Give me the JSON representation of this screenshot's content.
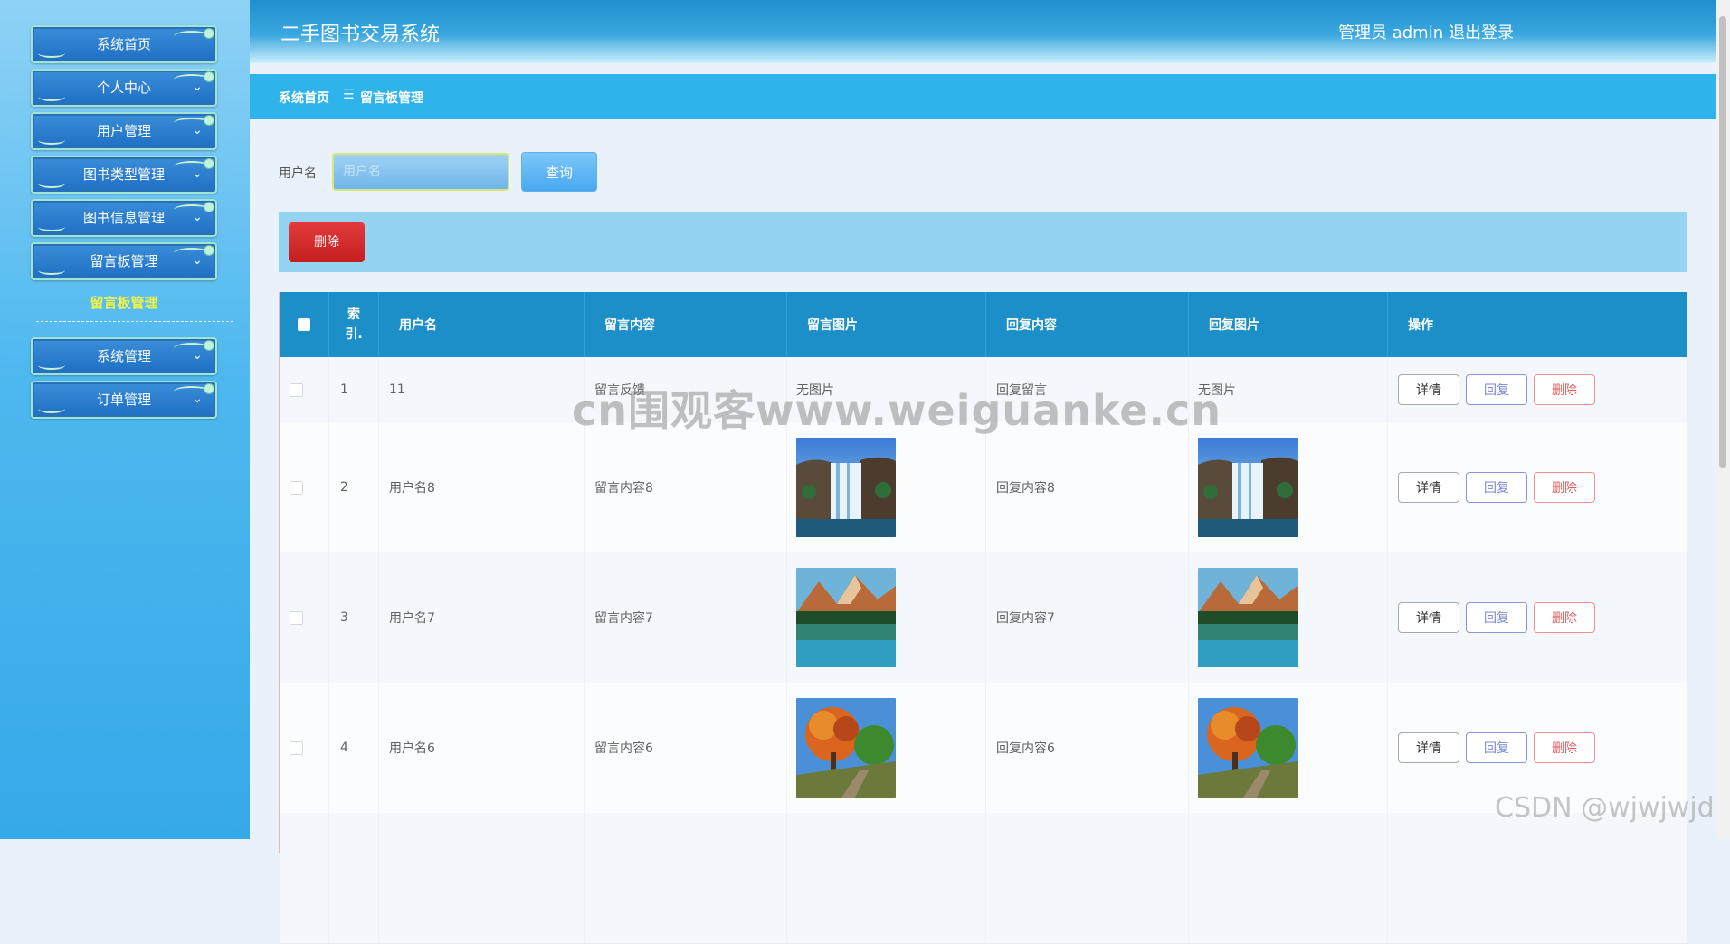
{
  "sidebar": {
    "items": [
      {
        "label": "系统首页"
      },
      {
        "label": "个人中心"
      },
      {
        "label": "用户管理"
      },
      {
        "label": "图书类型管理"
      },
      {
        "label": "图书信息管理"
      },
      {
        "label": "留言板管理"
      },
      {
        "label": "系统管理"
      },
      {
        "label": "订单管理"
      }
    ],
    "active_sub_item": "留言板管理"
  },
  "header": {
    "title": "二手图书交易系统",
    "user_label": "管理员 admin",
    "logout_label": "退出登录"
  },
  "breadcrumb": {
    "home": "系统首页",
    "separator": "☰",
    "current": "留言板管理"
  },
  "search": {
    "label": "用户名",
    "placeholder": "用户名",
    "value": "",
    "button_label": "查询"
  },
  "actions": {
    "delete_label": "删除"
  },
  "table": {
    "columns": [
      "",
      "索引",
      "用户名",
      "留言内容",
      "留言图片",
      "回复内容",
      "回复图片",
      "操作"
    ],
    "column_index_label": [
      "索",
      "引."
    ],
    "rows": [
      {
        "index": "1",
        "username": "11",
        "content": "留言反馈",
        "image": "无图片",
        "reply": "回复留言",
        "reply_image": "无图片",
        "image_kind": "none"
      },
      {
        "index": "2",
        "username": "用户名8",
        "content": "留言内容8",
        "image": "",
        "reply": "回复内容8",
        "reply_image": "",
        "image_kind": "waterfall"
      },
      {
        "index": "3",
        "username": "用户名7",
        "content": "留言内容7",
        "image": "",
        "reply": "回复内容7",
        "reply_image": "",
        "image_kind": "mountain-lake"
      },
      {
        "index": "4",
        "username": "用户名6",
        "content": "留言内容6",
        "image": "",
        "reply": "回复内容6",
        "reply_image": "",
        "image_kind": "autumn-tree"
      },
      {
        "index": "",
        "username": "",
        "content": "",
        "image": "",
        "reply": "",
        "reply_image": "",
        "image_kind": "partial"
      }
    ],
    "row_actions": {
      "detail": "详情",
      "reply": "回复",
      "delete": "删除"
    }
  },
  "watermark": "cn围观客www.weiguanke.cn",
  "csdn_watermark": "CSDN @wjwjwjd",
  "colors": {
    "header": "#1f8fce",
    "breadcrumb_bar": "#2eb3ea",
    "table_header": "#1d8fc8",
    "active_sub_item": "#f5f542",
    "delete": "#c41e1e"
  }
}
